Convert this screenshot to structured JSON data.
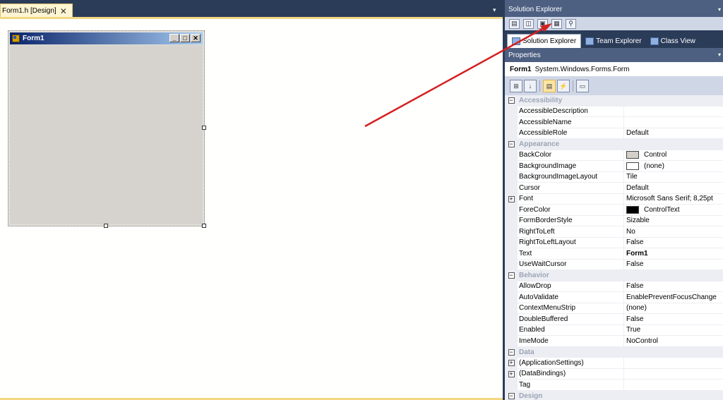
{
  "document_tab": {
    "title": "Form1.h [Design]",
    "close_glyph": "✕",
    "dropdown_glyph": "▾"
  },
  "form": {
    "title": "Form1",
    "buttons": {
      "minimize": "_",
      "maximize": "□",
      "close": "✕"
    },
    "client_color": "#d6d3ce"
  },
  "solution_explorer": {
    "title": "Solution Explorer",
    "pin_glyph": "▾",
    "tabs": [
      {
        "label": "Solution Explorer",
        "active": true
      },
      {
        "label": "Team Explorer",
        "active": false
      },
      {
        "label": "Class View",
        "active": false
      }
    ]
  },
  "properties": {
    "title": "Properties",
    "pin_glyph": "▾",
    "object_name": "Form1",
    "object_type": "System.Windows.Forms.Form",
    "categories": [
      {
        "name": "Accessibility",
        "rows": [
          {
            "name": "AccessibleDescription",
            "value": ""
          },
          {
            "name": "AccessibleName",
            "value": ""
          },
          {
            "name": "AccessibleRole",
            "value": "Default"
          }
        ]
      },
      {
        "name": "Appearance",
        "rows": [
          {
            "name": "BackColor",
            "value": "Control",
            "swatch": "#d4d0c8"
          },
          {
            "name": "BackgroundImage",
            "value": "(none)",
            "swatch": "#ffffff"
          },
          {
            "name": "BackgroundImageLayout",
            "value": "Tile"
          },
          {
            "name": "Cursor",
            "value": "Default"
          },
          {
            "name": "Font",
            "value": "Microsoft Sans Serif; 8,25pt",
            "expandable": true
          },
          {
            "name": "ForeColor",
            "value": "ControlText",
            "swatch": "#000000"
          },
          {
            "name": "FormBorderStyle",
            "value": "Sizable"
          },
          {
            "name": "RightToLeft",
            "value": "No"
          },
          {
            "name": "RightToLeftLayout",
            "value": "False"
          },
          {
            "name": "Text",
            "value": "Form1",
            "bold": true
          },
          {
            "name": "UseWaitCursor",
            "value": "False"
          }
        ]
      },
      {
        "name": "Behavior",
        "rows": [
          {
            "name": "AllowDrop",
            "value": "False"
          },
          {
            "name": "AutoValidate",
            "value": "EnablePreventFocusChange"
          },
          {
            "name": "ContextMenuStrip",
            "value": "(none)"
          },
          {
            "name": "DoubleBuffered",
            "value": "False"
          },
          {
            "name": "Enabled",
            "value": "True"
          },
          {
            "name": "ImeMode",
            "value": "NoControl"
          }
        ]
      },
      {
        "name": "Data",
        "rows": [
          {
            "name": "(ApplicationSettings)",
            "value": "",
            "expandable": true
          },
          {
            "name": "(DataBindings)",
            "value": "",
            "expandable": true
          },
          {
            "name": "Tag",
            "value": ""
          }
        ]
      },
      {
        "name": "Design",
        "rows": []
      }
    ]
  },
  "annotation": {
    "color": "#d42020"
  }
}
